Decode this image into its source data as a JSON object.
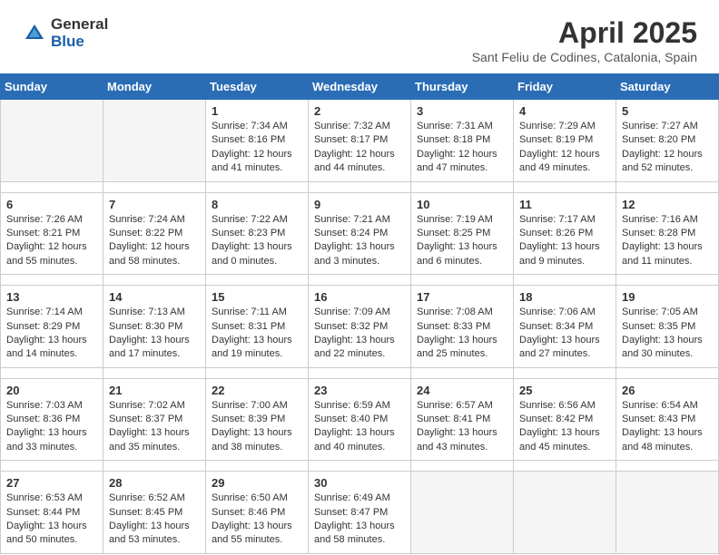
{
  "header": {
    "logo_general": "General",
    "logo_blue": "Blue",
    "title": "April 2025",
    "subtitle": "Sant Feliu de Codines, Catalonia, Spain"
  },
  "weekdays": [
    "Sunday",
    "Monday",
    "Tuesday",
    "Wednesday",
    "Thursday",
    "Friday",
    "Saturday"
  ],
  "weeks": [
    [
      {
        "day": "",
        "empty": true
      },
      {
        "day": "",
        "empty": true
      },
      {
        "day": "1",
        "sunrise": "7:34 AM",
        "sunset": "8:16 PM",
        "daylight": "12 hours and 41 minutes."
      },
      {
        "day": "2",
        "sunrise": "7:32 AM",
        "sunset": "8:17 PM",
        "daylight": "12 hours and 44 minutes."
      },
      {
        "day": "3",
        "sunrise": "7:31 AM",
        "sunset": "8:18 PM",
        "daylight": "12 hours and 47 minutes."
      },
      {
        "day": "4",
        "sunrise": "7:29 AM",
        "sunset": "8:19 PM",
        "daylight": "12 hours and 49 minutes."
      },
      {
        "day": "5",
        "sunrise": "7:27 AM",
        "sunset": "8:20 PM",
        "daylight": "12 hours and 52 minutes."
      }
    ],
    [
      {
        "day": "6",
        "sunrise": "7:26 AM",
        "sunset": "8:21 PM",
        "daylight": "12 hours and 55 minutes."
      },
      {
        "day": "7",
        "sunrise": "7:24 AM",
        "sunset": "8:22 PM",
        "daylight": "12 hours and 58 minutes."
      },
      {
        "day": "8",
        "sunrise": "7:22 AM",
        "sunset": "8:23 PM",
        "daylight": "13 hours and 0 minutes."
      },
      {
        "day": "9",
        "sunrise": "7:21 AM",
        "sunset": "8:24 PM",
        "daylight": "13 hours and 3 minutes."
      },
      {
        "day": "10",
        "sunrise": "7:19 AM",
        "sunset": "8:25 PM",
        "daylight": "13 hours and 6 minutes."
      },
      {
        "day": "11",
        "sunrise": "7:17 AM",
        "sunset": "8:26 PM",
        "daylight": "13 hours and 9 minutes."
      },
      {
        "day": "12",
        "sunrise": "7:16 AM",
        "sunset": "8:28 PM",
        "daylight": "13 hours and 11 minutes."
      }
    ],
    [
      {
        "day": "13",
        "sunrise": "7:14 AM",
        "sunset": "8:29 PM",
        "daylight": "13 hours and 14 minutes."
      },
      {
        "day": "14",
        "sunrise": "7:13 AM",
        "sunset": "8:30 PM",
        "daylight": "13 hours and 17 minutes."
      },
      {
        "day": "15",
        "sunrise": "7:11 AM",
        "sunset": "8:31 PM",
        "daylight": "13 hours and 19 minutes."
      },
      {
        "day": "16",
        "sunrise": "7:09 AM",
        "sunset": "8:32 PM",
        "daylight": "13 hours and 22 minutes."
      },
      {
        "day": "17",
        "sunrise": "7:08 AM",
        "sunset": "8:33 PM",
        "daylight": "13 hours and 25 minutes."
      },
      {
        "day": "18",
        "sunrise": "7:06 AM",
        "sunset": "8:34 PM",
        "daylight": "13 hours and 27 minutes."
      },
      {
        "day": "19",
        "sunrise": "7:05 AM",
        "sunset": "8:35 PM",
        "daylight": "13 hours and 30 minutes."
      }
    ],
    [
      {
        "day": "20",
        "sunrise": "7:03 AM",
        "sunset": "8:36 PM",
        "daylight": "13 hours and 33 minutes."
      },
      {
        "day": "21",
        "sunrise": "7:02 AM",
        "sunset": "8:37 PM",
        "daylight": "13 hours and 35 minutes."
      },
      {
        "day": "22",
        "sunrise": "7:00 AM",
        "sunset": "8:39 PM",
        "daylight": "13 hours and 38 minutes."
      },
      {
        "day": "23",
        "sunrise": "6:59 AM",
        "sunset": "8:40 PM",
        "daylight": "13 hours and 40 minutes."
      },
      {
        "day": "24",
        "sunrise": "6:57 AM",
        "sunset": "8:41 PM",
        "daylight": "13 hours and 43 minutes."
      },
      {
        "day": "25",
        "sunrise": "6:56 AM",
        "sunset": "8:42 PM",
        "daylight": "13 hours and 45 minutes."
      },
      {
        "day": "26",
        "sunrise": "6:54 AM",
        "sunset": "8:43 PM",
        "daylight": "13 hours and 48 minutes."
      }
    ],
    [
      {
        "day": "27",
        "sunrise": "6:53 AM",
        "sunset": "8:44 PM",
        "daylight": "13 hours and 50 minutes."
      },
      {
        "day": "28",
        "sunrise": "6:52 AM",
        "sunset": "8:45 PM",
        "daylight": "13 hours and 53 minutes."
      },
      {
        "day": "29",
        "sunrise": "6:50 AM",
        "sunset": "8:46 PM",
        "daylight": "13 hours and 55 minutes."
      },
      {
        "day": "30",
        "sunrise": "6:49 AM",
        "sunset": "8:47 PM",
        "daylight": "13 hours and 58 minutes."
      },
      {
        "day": "",
        "empty": true
      },
      {
        "day": "",
        "empty": true
      },
      {
        "day": "",
        "empty": true
      }
    ]
  ],
  "labels": {
    "sunrise": "Sunrise:",
    "sunset": "Sunset:",
    "daylight": "Daylight:"
  }
}
